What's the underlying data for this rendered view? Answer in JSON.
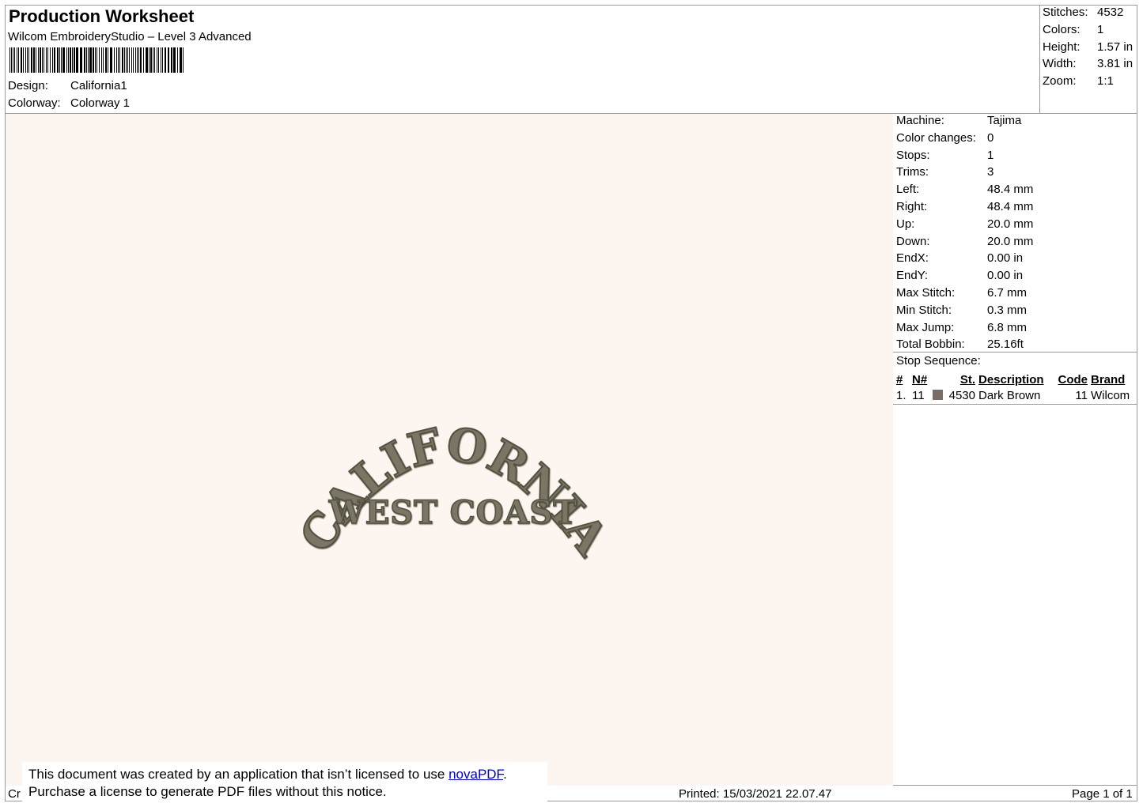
{
  "header": {
    "title": "Production Worksheet",
    "subtitle": "Wilcom EmbroideryStudio – Level 3 Advanced",
    "design_label": "Design:",
    "design_value": "California1",
    "colorway_label": "Colorway:",
    "colorway_value": "Colorway 1"
  },
  "summary": [
    {
      "label": "Stitches:",
      "value": "4532"
    },
    {
      "label": "Colors:",
      "value": "1"
    },
    {
      "label": "Height:",
      "value": "1.57 in"
    },
    {
      "label": "Width:",
      "value": "3.81 in"
    },
    {
      "label": "Zoom:",
      "value": "1:1"
    }
  ],
  "machine_info": [
    {
      "label": "Machine:",
      "value": "Tajima"
    },
    {
      "label": "Color changes:",
      "value": "0"
    },
    {
      "label": "Stops:",
      "value": "1"
    },
    {
      "label": "Trims:",
      "value": "3"
    },
    {
      "label": "Left:",
      "value": "48.4 mm"
    },
    {
      "label": "Right:",
      "value": "48.4 mm"
    },
    {
      "label": "Up:",
      "value": "20.0 mm"
    },
    {
      "label": "Down:",
      "value": "20.0 mm"
    },
    {
      "label": "EndX:",
      "value": "0.00 in"
    },
    {
      "label": "EndY:",
      "value": "0.00 in"
    },
    {
      "label": "Max Stitch:",
      "value": "6.7 mm"
    },
    {
      "label": "Min Stitch:",
      "value": "0.3 mm"
    },
    {
      "label": "Max Jump:",
      "value": "6.8 mm"
    },
    {
      "label": "Total Bobbin:",
      "value": "25.16ft"
    }
  ],
  "stop_sequence": {
    "title": "Stop Sequence:",
    "headers": [
      "#",
      "N#",
      "St.",
      "Description",
      "Code",
      "Brand"
    ],
    "rows": [
      {
        "idx": "1.",
        "n": "11",
        "color": "#7a6e64",
        "st": "4530",
        "description": "Dark Brown",
        "code": "11",
        "brand": "Wilcom"
      }
    ]
  },
  "design": {
    "arc_text": "CALIFORNIA",
    "line_text": "WEST COAST",
    "thread_color": "#7a7565"
  },
  "footer": {
    "left_fragment": "Cr",
    "printed": "Printed: 15/03/2021 22.07.47",
    "page": "Page 1 of 1"
  },
  "notice": {
    "line1_prefix": "This document was created by an application that isn’t licensed to use ",
    "link": "novaPDF",
    "line1_suffix": ".",
    "line2": "Purchase a license to generate PDF files without this notice."
  }
}
